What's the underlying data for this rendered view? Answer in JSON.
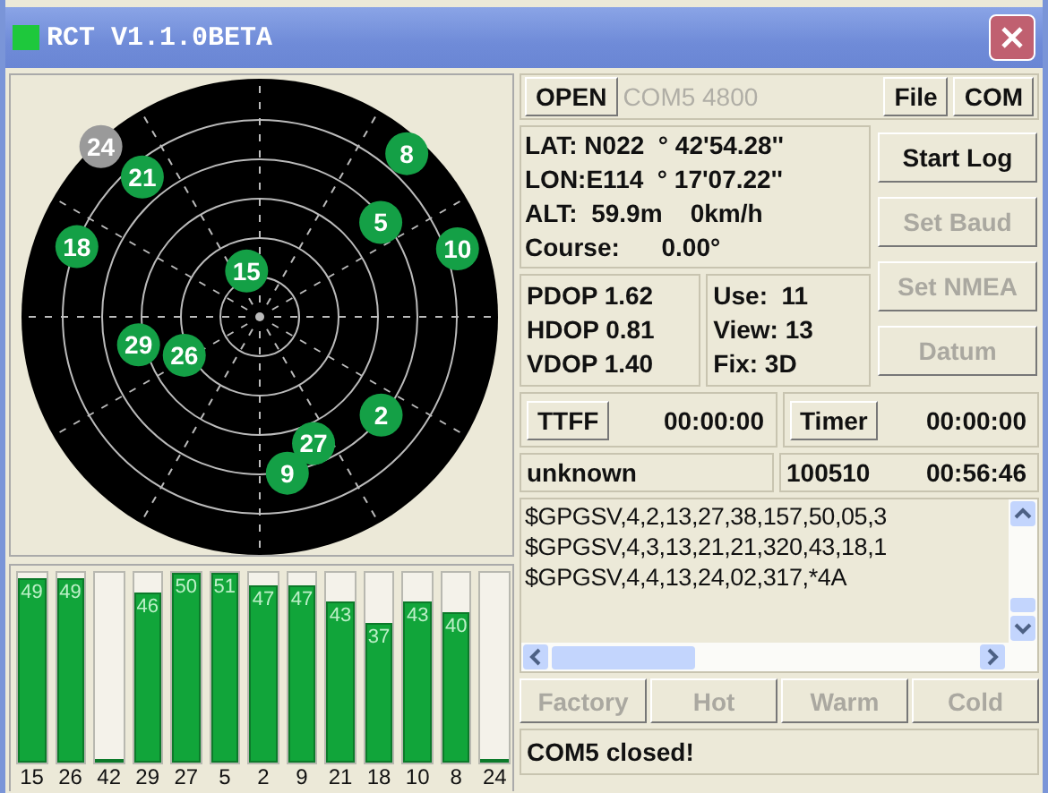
{
  "window": {
    "title": "RCT V1.1.0BETA"
  },
  "satellites": [
    {
      "prn": "24",
      "used": false
    },
    {
      "prn": "21",
      "used": true
    },
    {
      "prn": "8",
      "used": true
    },
    {
      "prn": "5",
      "used": true
    },
    {
      "prn": "10",
      "used": true
    },
    {
      "prn": "18",
      "used": true
    },
    {
      "prn": "15",
      "used": true
    },
    {
      "prn": "29",
      "used": true
    },
    {
      "prn": "26",
      "used": true
    },
    {
      "prn": "2",
      "used": true
    },
    {
      "prn": "27",
      "used": true
    },
    {
      "prn": "9",
      "used": true
    }
  ],
  "signal_bars": [
    {
      "prn": "15",
      "snr": "49",
      "level": 0.97
    },
    {
      "prn": "26",
      "snr": "49",
      "level": 0.97
    },
    {
      "prn": "42",
      "level": 0
    },
    {
      "prn": "29",
      "snr": "46",
      "level": 0.9
    },
    {
      "prn": "27",
      "snr": "50",
      "level": 1
    },
    {
      "prn": "5",
      "snr": "51",
      "level": 1
    },
    {
      "prn": "2",
      "snr": "47",
      "level": 0.93
    },
    {
      "prn": "9",
      "snr": "47",
      "level": 0.93
    },
    {
      "prn": "21",
      "snr": "43",
      "level": 0.85
    },
    {
      "prn": "18",
      "snr": "37",
      "level": 0.74
    },
    {
      "prn": "10",
      "snr": "43",
      "level": 0.85
    },
    {
      "prn": "8",
      "snr": "40",
      "level": 0.79
    },
    {
      "prn": "24",
      "level": 0
    }
  ],
  "port_bar": {
    "open_button": "OPEN",
    "port": "COM5 4800",
    "file_button": "File",
    "com_button": "COM"
  },
  "position": {
    "lat": "LAT: N022  ° 42'54.28''",
    "lon": "LON:E114  ° 17'07.22''",
    "alt": "ALT:  59.9m    0km/h",
    "course": "Course:      0.00°"
  },
  "side_buttons": [
    {
      "label": "Start Log",
      "disabled": false
    },
    {
      "label": "Set Baud",
      "disabled": true
    },
    {
      "label": "Set NMEA",
      "disabled": true
    },
    {
      "label": "Datum",
      "disabled": true
    }
  ],
  "dop": [
    "PDOP 1.62",
    "HDOP 0.81",
    "VDOP 1.40"
  ],
  "fix": [
    "Use:  11",
    "View: 13",
    "Fix: 3D"
  ],
  "ttff": {
    "button": "TTFF",
    "value": "00:00:00"
  },
  "timer": {
    "button": "Timer",
    "value": "00:00:00"
  },
  "status_row": {
    "mode": "unknown",
    "date": "100510",
    "time": "00:56:46"
  },
  "nmea_lines": [
    "$GPGSV,4,2,13,27,38,157,50,05,3",
    "$GPGSV,4,3,13,21,21,320,43,18,1",
    "$GPGSV,4,4,13,24,02,317,*4A"
  ],
  "reset_buttons": [
    {
      "label": "Factory",
      "disabled": true
    },
    {
      "label": "Hot",
      "disabled": true
    },
    {
      "label": "Warm",
      "disabled": true
    },
    {
      "label": "Cold",
      "disabled": true
    }
  ],
  "status_bar": "COM5 closed!"
}
